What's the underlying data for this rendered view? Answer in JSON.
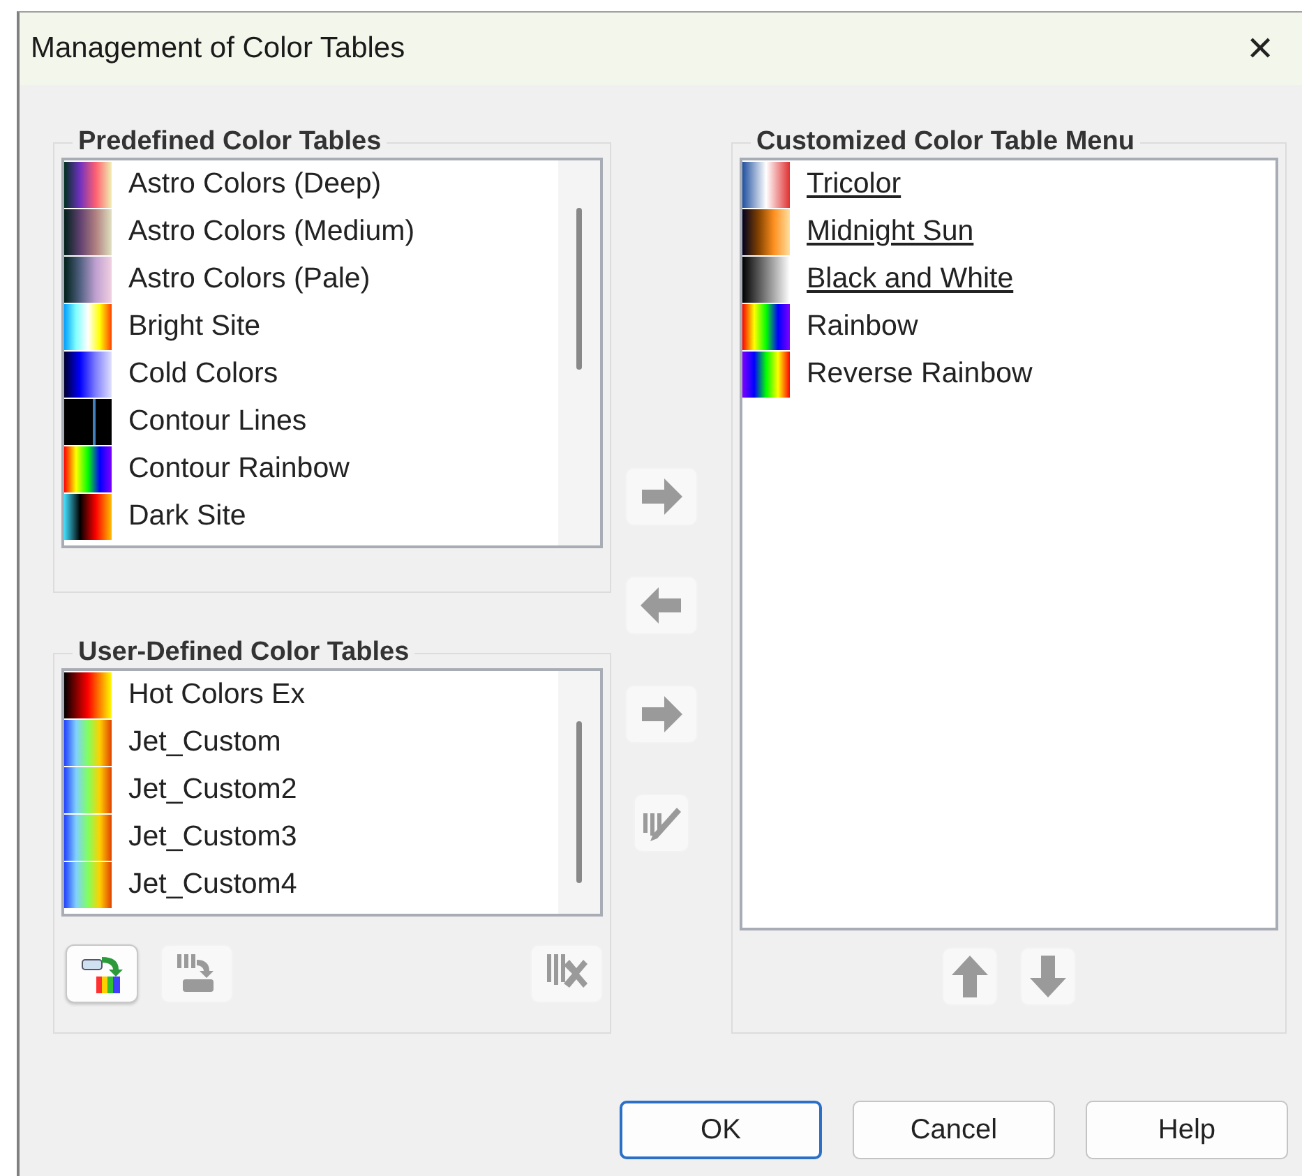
{
  "window": {
    "title": "Management of Color Tables",
    "close": "✕"
  },
  "predefined": {
    "title": "Predefined Color Tables",
    "items": [
      {
        "label": "Astro Colors (Deep)",
        "kind": "astrodeep"
      },
      {
        "label": "Astro Colors (Medium)",
        "kind": "astromedium"
      },
      {
        "label": "Astro Colors (Pale)",
        "kind": "astropale"
      },
      {
        "label": "Bright Site",
        "kind": "brightsite"
      },
      {
        "label": "Cold Colors",
        "kind": "cold"
      },
      {
        "label": "Contour Lines",
        "kind": "contour"
      },
      {
        "label": "Contour Rainbow",
        "kind": "contourrainbow"
      },
      {
        "label": "Dark Site",
        "kind": "darksite"
      }
    ]
  },
  "user_defined": {
    "title": "User-Defined Color Tables",
    "items": [
      {
        "label": "Hot Colors Ex",
        "kind": "hot"
      },
      {
        "label": "Jet_Custom",
        "kind": "jet"
      },
      {
        "label": "Jet_Custom2",
        "kind": "jet"
      },
      {
        "label": "Jet_Custom3",
        "kind": "jet"
      },
      {
        "label": "Jet_Custom4",
        "kind": "jet"
      }
    ],
    "tools": [
      {
        "kind": "import",
        "disabled": false
      },
      {
        "kind": "export",
        "disabled": true
      },
      {
        "kind": "delete",
        "disabled": true
      }
    ]
  },
  "transfer": [
    {
      "kind": "right",
      "disabled": true
    },
    {
      "kind": "left",
      "disabled": true
    },
    {
      "kind": "right",
      "disabled": true
    },
    {
      "kind": "edit",
      "disabled": true
    }
  ],
  "custom": {
    "title": "Customized Color Table Menu",
    "items": [
      {
        "label": "Tricolor",
        "underlined": true,
        "kind": "tricolor"
      },
      {
        "label": "Midnight Sun",
        "underlined": true,
        "kind": "midnightsun"
      },
      {
        "label": "Black and White",
        "underlined": true,
        "kind": "blackwhite"
      },
      {
        "label": "Rainbow",
        "underlined": false,
        "kind": "rainbow"
      },
      {
        "label": "Reverse Rainbow",
        "underlined": false,
        "kind": "reverserainbow"
      }
    ],
    "tools": [
      {
        "kind": "up",
        "disabled": true
      },
      {
        "kind": "down",
        "disabled": true
      }
    ]
  },
  "buttons": [
    {
      "label": "OK",
      "default": true
    },
    {
      "label": "Cancel",
      "default": false
    },
    {
      "label": "Help",
      "default": false
    }
  ]
}
